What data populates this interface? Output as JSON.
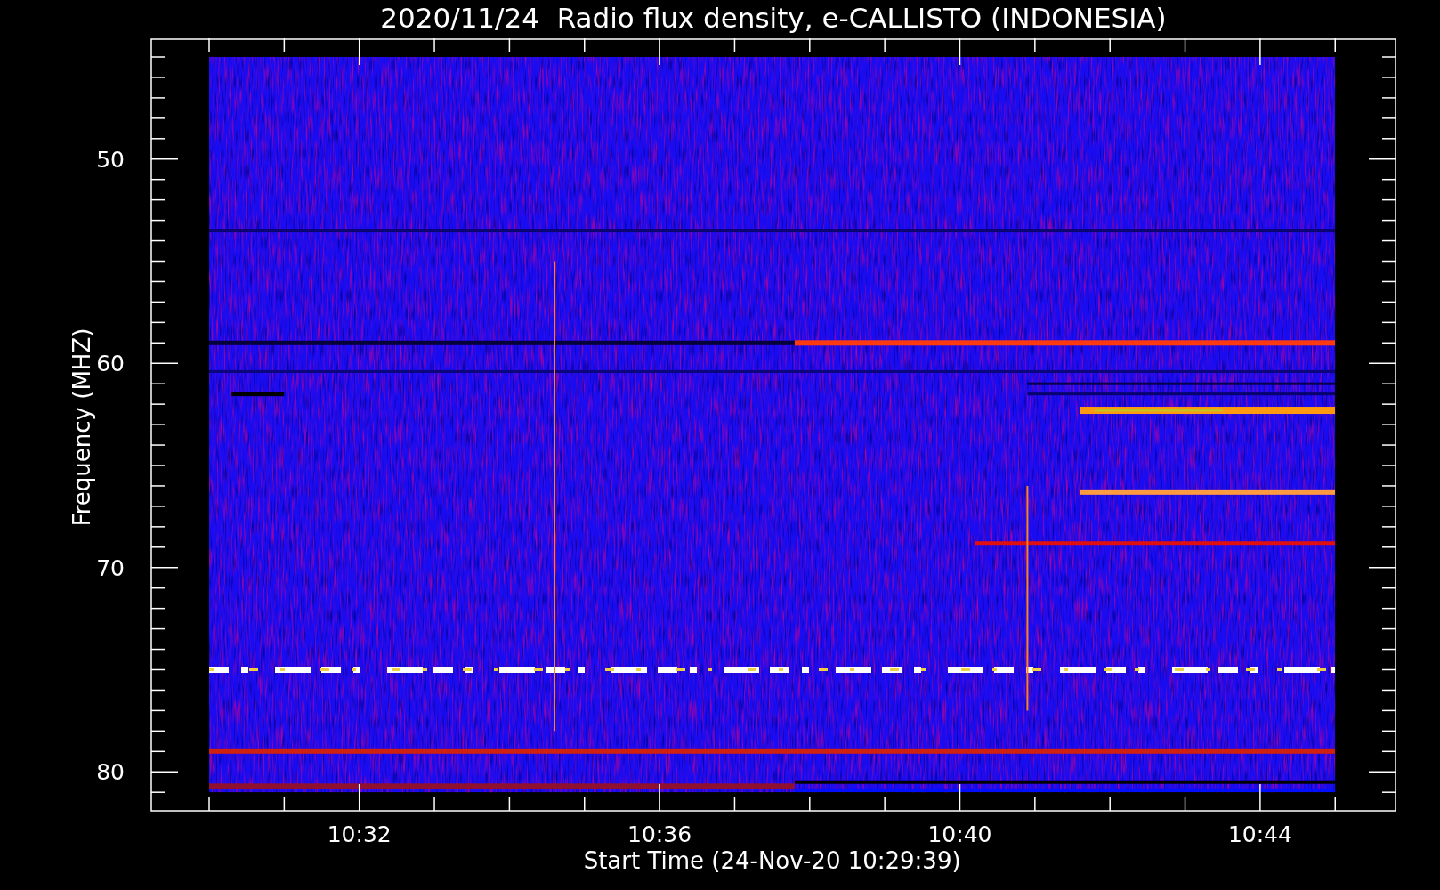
{
  "title": "2020/11/24  Radio flux density, e-CALLISTO (INDONESIA)",
  "y_axis": {
    "label": "Frequency (MHZ)",
    "ticks": [
      "50",
      "60",
      "70",
      "80"
    ]
  },
  "x_axis": {
    "label": "Start Time (24-Nov-20 10:29:39)",
    "ticks": [
      "10:32",
      "10:36",
      "10:40",
      "10:44"
    ]
  }
}
